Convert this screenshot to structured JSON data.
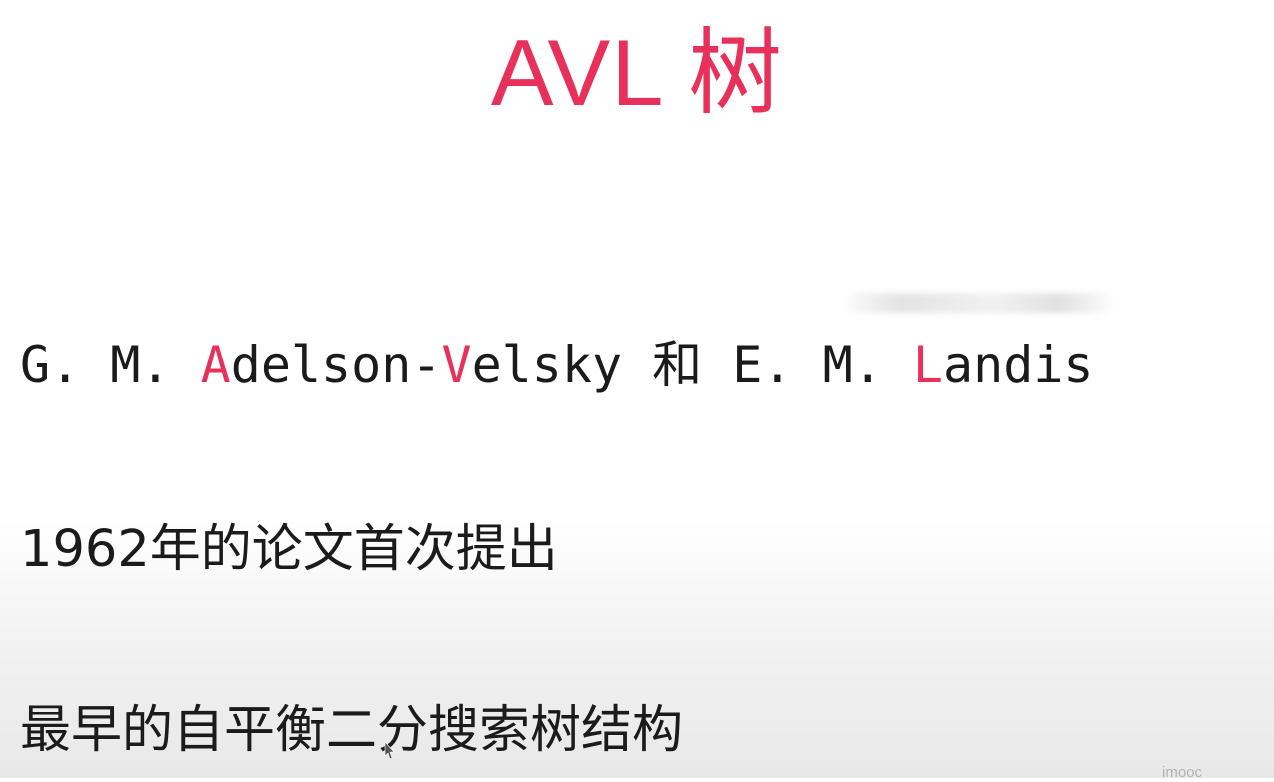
{
  "slide": {
    "title": "AVL 树",
    "authors": {
      "p1": "G. M. ",
      "a": "A",
      "p2": "delson-",
      "v": "V",
      "p3": "elsky 和 E. M. ",
      "l": "L",
      "p4": "andis"
    },
    "line1": "1962年的论文首次提出",
    "line2": "最早的自平衡二分搜索树结构",
    "watermark": "imooc"
  },
  "colors": {
    "accent": "#e8315a",
    "text": "#1b1b1b",
    "background": "#ffffff"
  },
  "icons": {
    "cursor": "mouse-cursor-icon"
  }
}
